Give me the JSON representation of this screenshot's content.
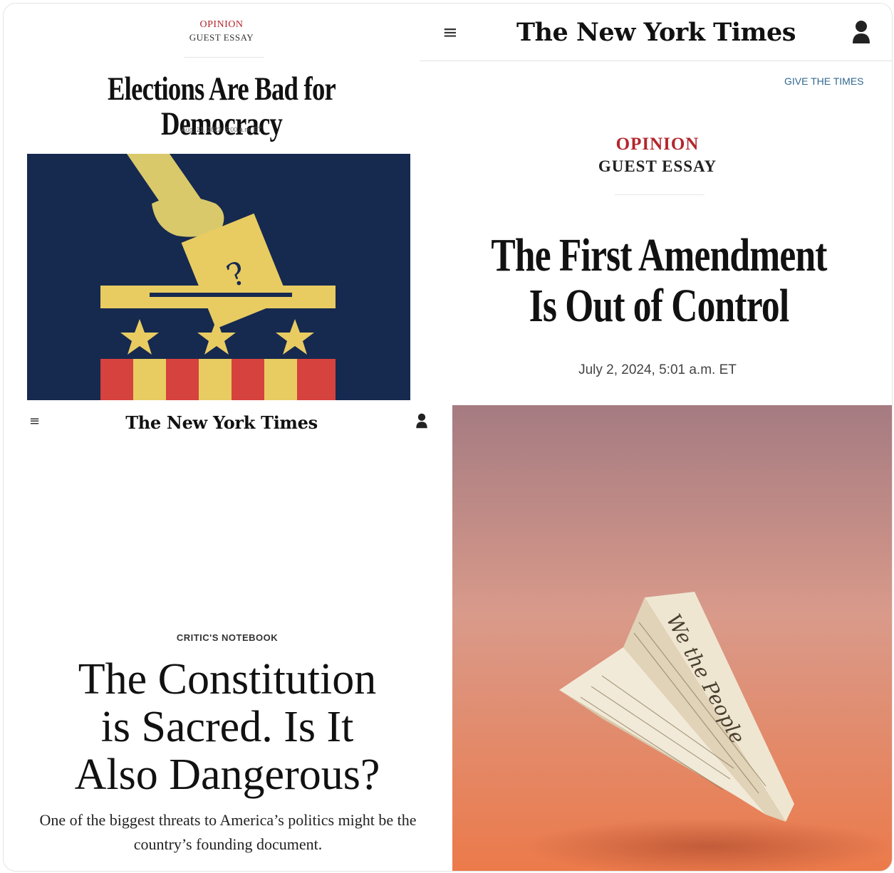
{
  "panel_top_left": {
    "section": "OPINION",
    "label": "GUEST ESSAY",
    "headline": "Elections Are Bad for Democracy",
    "date": "Aug. 21, 2023, 5:00 a.m. ET",
    "illustration_note": "?",
    "colors": {
      "background": "#16294f",
      "accent": "#e8cc62",
      "stripe_red": "#d6423d"
    }
  },
  "panel_top_right": {
    "logo": "The New York Times",
    "menu_icon": "hamburger-icon",
    "user_icon": "user-icon",
    "give_link": "GIVE THE TIMES",
    "section": "OPINION",
    "label": "GUEST ESSAY",
    "headline": "The First Amendment Is Out of Control",
    "date": "July 2, 2024, 5:01 a.m. ET"
  },
  "panel_bottom_left": {
    "logo": "The New York Times",
    "menu_icon": "hamburger-icon",
    "user_icon": "user-icon",
    "kicker": "CRITIC'S NOTEBOOK",
    "headline_lines": [
      "The Constitution",
      "is Sacred. Is It",
      "Also Dangerous?"
    ],
    "summary": "One of the biggest threats to America’s politics might be the country’s founding document."
  },
  "panel_bottom_right": {
    "image_text": "We the People",
    "colors": {
      "top": "#a57b82",
      "bottom": "#ec7a4a",
      "paper": "#efe6d2"
    }
  }
}
